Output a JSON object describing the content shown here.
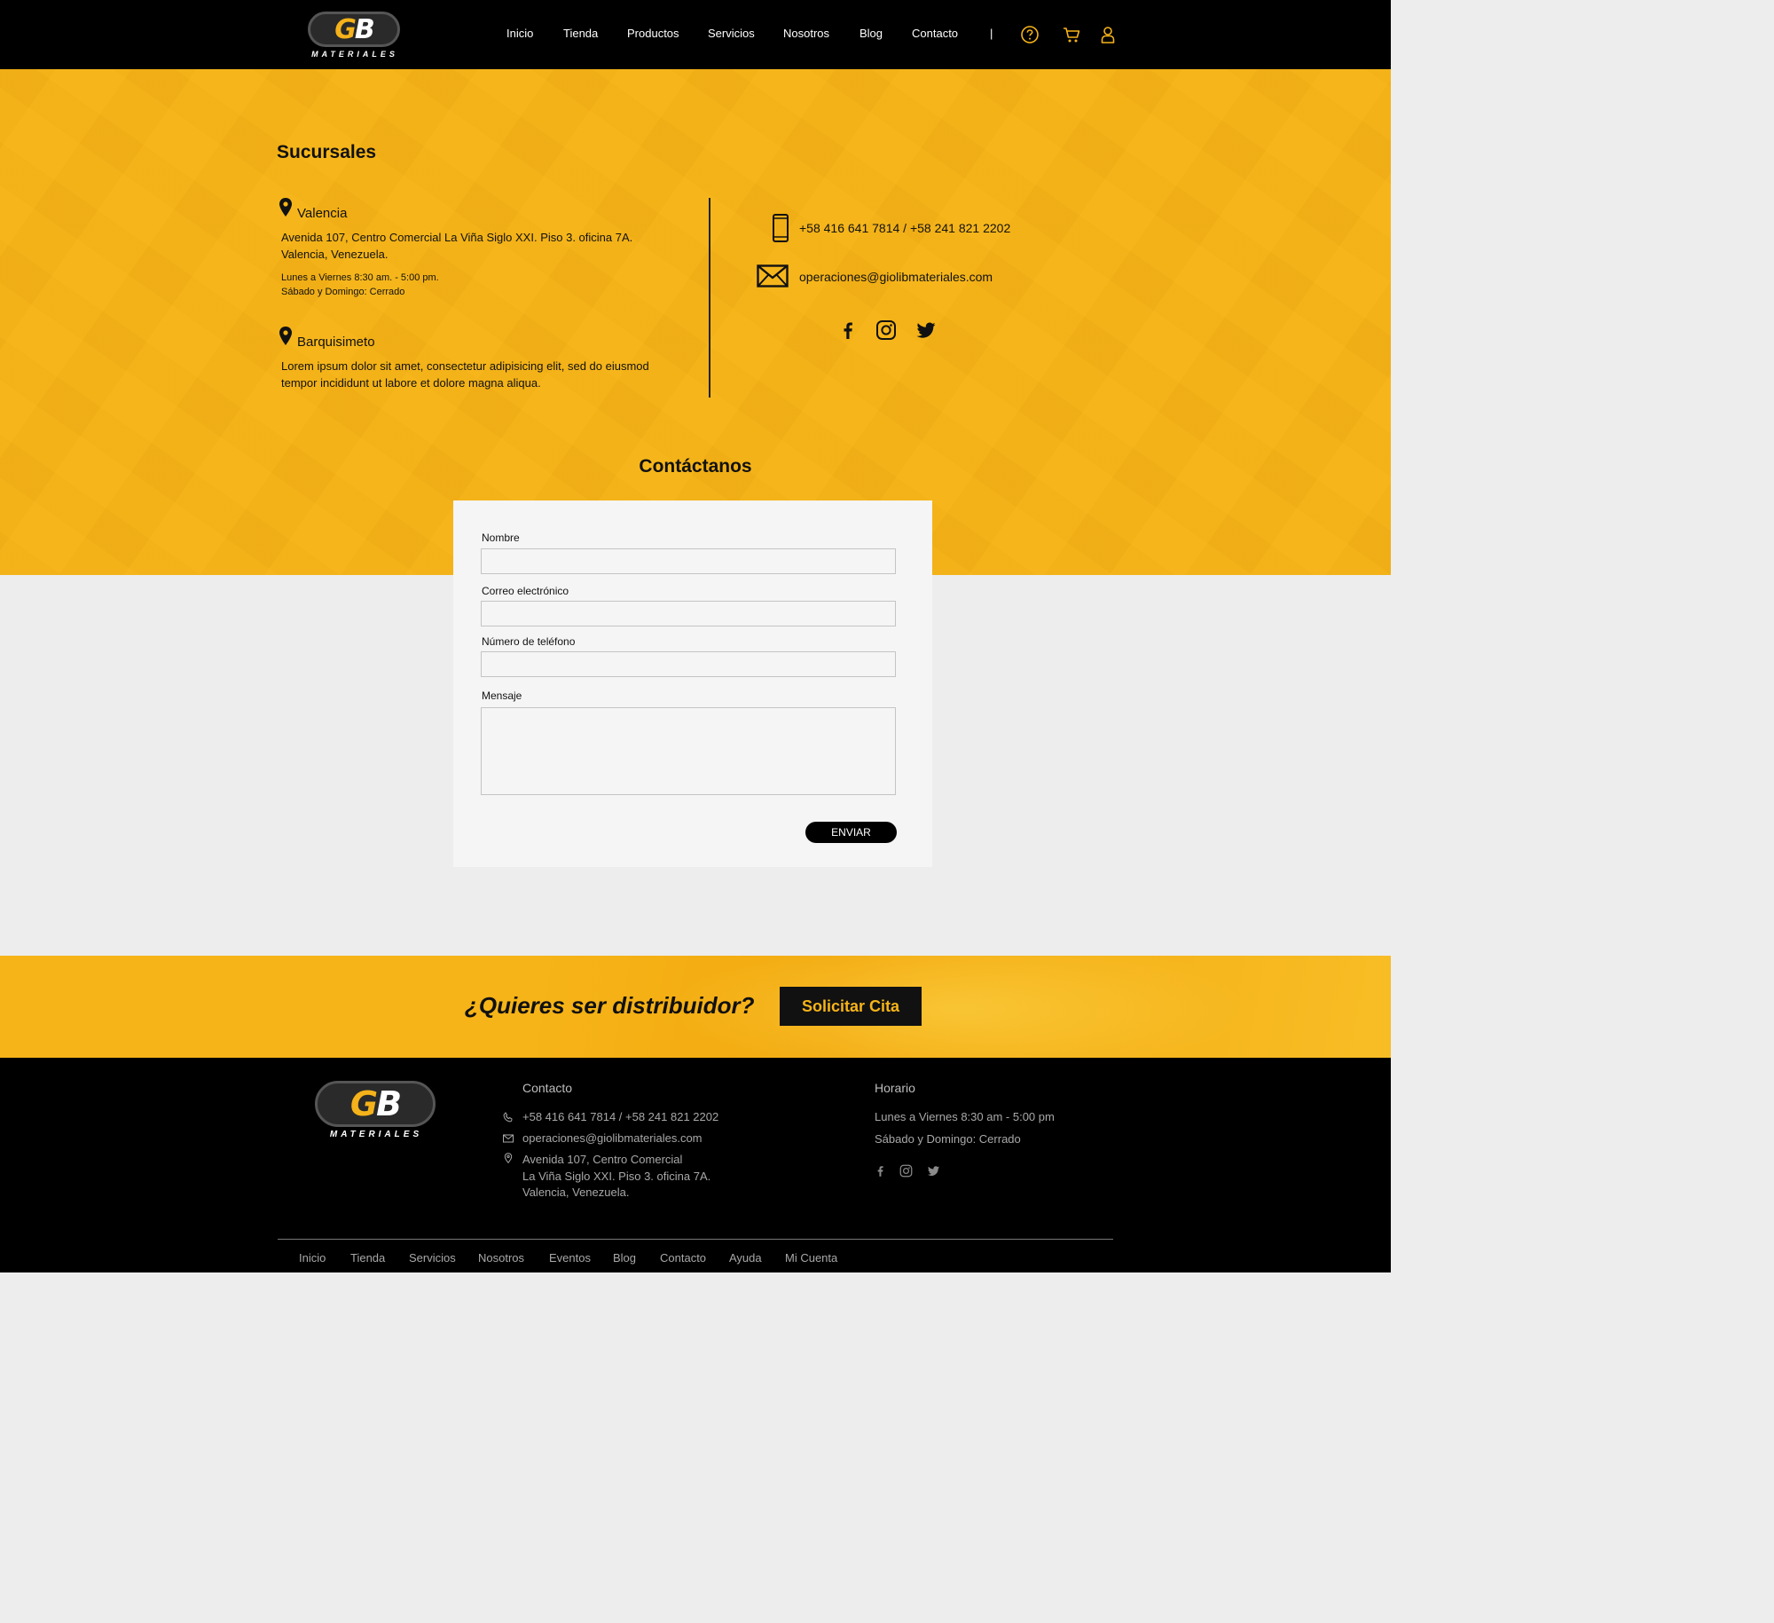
{
  "brand": {
    "logo_mark": "GB",
    "logo_word": "MATERIALES"
  },
  "header": {
    "nav": [
      "Inicio",
      "Tienda",
      "Productos",
      "Servicios",
      "Nosotros",
      "Blog",
      "Contacto"
    ],
    "separator": "|",
    "icons": [
      "help-icon",
      "cart-icon",
      "user-icon"
    ],
    "accent": "#f6b418"
  },
  "branches": {
    "title": "Sucursales",
    "items": [
      {
        "city": "Valencia",
        "address_line1": "Avenida 107, Centro Comercial La Viña Siglo XXI. Piso 3. oficina 7A.",
        "address_line2": "Valencia, Venezuela.",
        "hours_line1": "Lunes a Viernes 8:30 am. - 5:00 pm.",
        "hours_line2": "Sábado y Domingo: Cerrado"
      },
      {
        "city": "Barquisimeto",
        "address_line1": "Lorem ipsum dolor sit amet, consectetur adipisicing elit, sed do eiusmod",
        "address_line2": "tempor incididunt ut labore et dolore magna aliqua."
      }
    ]
  },
  "contact_info": {
    "phone": "+58 416 641 7814 / +58 241 821 2202",
    "email": "operaciones@giolibmateriales.com",
    "social": [
      "facebook-icon",
      "instagram-icon",
      "twitter-icon"
    ]
  },
  "contact_form": {
    "title": "Contáctanos",
    "fields": [
      {
        "label": "Nombre",
        "value": "",
        "placeholder": ""
      },
      {
        "label": "Correo electrónico",
        "value": "",
        "placeholder": ""
      },
      {
        "label": "Número de teléfono",
        "value": "",
        "placeholder": ""
      },
      {
        "label": "Mensaje",
        "value": "",
        "placeholder": ""
      }
    ],
    "submit": "ENVIAR"
  },
  "distributor": {
    "question": "¿Quieres ser distribuidor?",
    "button": "Solicitar Cita"
  },
  "footer": {
    "contact_heading": "Contacto",
    "phone": "+58 416 641 7814 / +58 241 821 2202",
    "email": "operaciones@giolibmateriales.com",
    "address_line1": "Avenida 107, Centro Comercial",
    "address_line2": "La Viña Siglo XXI. Piso 3. oficina 7A.",
    "address_line3": "Valencia, Venezuela.",
    "hours_heading": "Horario",
    "hours_line1": "Lunes a Viernes 8:30 am - 5:00 pm",
    "hours_line2": "Sábado y Domingo: Cerrado",
    "nav": [
      "Inicio",
      "Tienda",
      "Servicios",
      "Nosotros",
      "Eventos",
      "Blog",
      "Contacto",
      "Ayuda",
      "Mi Cuenta"
    ]
  }
}
